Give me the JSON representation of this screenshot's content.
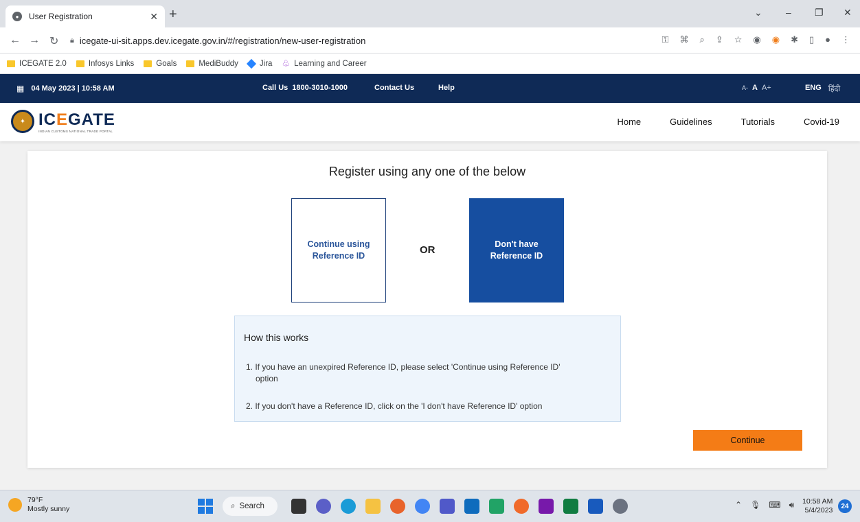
{
  "browser": {
    "tab_title": "User Registration",
    "url": "icegate-ui-sit.apps.dev.icegate.gov.in/#/registration/new-user-registration",
    "bookmarks": [
      {
        "label": "ICEGATE 2.0",
        "icon": "folder-icon"
      },
      {
        "label": "Infosys Links",
        "icon": "folder-icon"
      },
      {
        "label": "Goals",
        "icon": "folder-icon"
      },
      {
        "label": "MediBuddy",
        "icon": "folder-icon"
      },
      {
        "label": "Jira",
        "icon": "jira-icon"
      },
      {
        "label": "Learning and Career",
        "icon": "learning-icon"
      }
    ]
  },
  "topbar": {
    "date": "04 May 2023 | 10:58 AM",
    "call_label": "Call Us",
    "call_number": "1800-3010-1000",
    "contact": "Contact Us",
    "help": "Help",
    "font_small": "A-",
    "font_normal": "A",
    "font_large": "A+",
    "lang_en": "ENG",
    "lang_hi": "हिंदी"
  },
  "site": {
    "logo_text_pre": "IC",
    "logo_text_accent": "E",
    "logo_text_post": "GATE",
    "logo_tagline": "INDIAN CUSTOMS NATIONAL TRADE PORTAL",
    "nav": [
      "Home",
      "Guidelines",
      "Tutorials",
      "Covid-19"
    ]
  },
  "main": {
    "heading": "Register using any one of the below",
    "option_a": "Continue using Reference ID",
    "or": "OR",
    "option_b": "Don't have Reference ID",
    "how_title": "How this works",
    "how_1": "1. If you have an unexpired Reference ID, please select 'Continue using Reference ID'",
    "how_1_cont": "option",
    "how_2": "2. If you don't have a Reference ID, click on the 'I don't have Reference ID' option",
    "continue": "Continue"
  },
  "taskbar": {
    "temp": "79°F",
    "condition": "Mostly sunny",
    "search": "Search",
    "time": "10:58 AM",
    "date": "5/4/2023",
    "notifications": "24"
  },
  "colors": {
    "header_navy": "#0f2a56",
    "primary_blue": "#164ea0",
    "accent_orange": "#f47c16"
  }
}
